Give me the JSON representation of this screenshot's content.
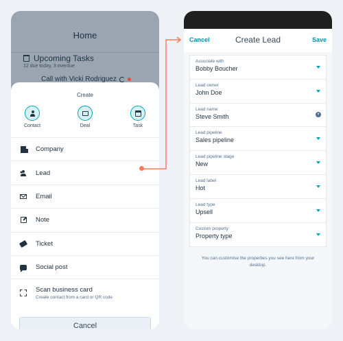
{
  "left": {
    "home_title": "Home",
    "tasks_title": "Upcoming Tasks",
    "tasks_subtitle": "12 due today, 3 overdue",
    "call_text": "Call with Vicki Rodriguez",
    "sheet": {
      "title": "Create",
      "quick_actions": [
        {
          "label": "Contact",
          "icon": "contact-icon"
        },
        {
          "label": "Deal",
          "icon": "deal-icon"
        },
        {
          "label": "Task",
          "icon": "task-icon"
        }
      ],
      "items": [
        {
          "label": "Company",
          "icon": "building-icon"
        },
        {
          "label": "Lead",
          "icon": "users-icon"
        },
        {
          "label": "Email",
          "icon": "mail-icon"
        },
        {
          "label": "Note",
          "icon": "note-icon"
        },
        {
          "label": "Ticket",
          "icon": "ticket-icon"
        },
        {
          "label": "Social post",
          "icon": "chat-icon"
        },
        {
          "label": "Scan business card",
          "sub": "Create contact from a card or QR code",
          "icon": "scan-icon"
        }
      ],
      "cancel_label": "Cancel"
    }
  },
  "right": {
    "cancel_label": "Cancel",
    "title": "Create Lead",
    "save_label": "Save",
    "fields": [
      {
        "label": "Associate with",
        "value": "Bobby Boucher",
        "control": "dropdown"
      },
      {
        "label": "Lead owner",
        "value": "John Doe",
        "control": "dropdown"
      },
      {
        "label": "Lead name",
        "value": "Steve Smith",
        "control": "clear"
      },
      {
        "label": "Lead pipeline",
        "value": "Sales pipeline",
        "control": "dropdown"
      },
      {
        "label": "Lead pipeline stage",
        "value": "New",
        "control": "dropdown"
      },
      {
        "label": "Lead label",
        "value": "Hot",
        "control": "dropdown"
      },
      {
        "label": "Lead type",
        "value": "Upsell",
        "control": "dropdown"
      },
      {
        "label": "Custom property",
        "value": "Property type",
        "control": "dropdown"
      }
    ],
    "footer_note": "You can customise the properties you see here from your desktop."
  },
  "colors": {
    "accent": "#00a4bd",
    "link": "#0091ae",
    "connector": "#ff7a59",
    "text": "#213343",
    "muted": "#516f90"
  }
}
